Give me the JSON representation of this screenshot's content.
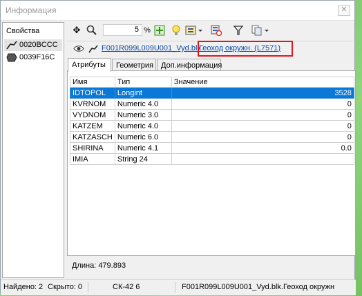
{
  "window": {
    "title": "Информация",
    "close": "✕"
  },
  "left_panel": {
    "header": "Свойства",
    "items": [
      {
        "label": "0020BCCC",
        "icon": "polyline-icon"
      },
      {
        "label": "0039F16C",
        "icon": "polygon-icon"
      }
    ]
  },
  "toolbar": {
    "zoom_value": "5",
    "percent_label": "%"
  },
  "object": {
    "file_link": "F001R099L009U001_Vyd.blk.",
    "layer_link": "Геоход окружн. (L7571)"
  },
  "tabs": [
    "Атрибуты",
    "Геометрия",
    "Доп.информация"
  ],
  "table": {
    "headers": [
      "Имя",
      "Тип",
      "Значение"
    ],
    "rows": [
      [
        "IDTOPOL",
        "Longint",
        "3528"
      ],
      [
        "KVRNOM",
        "Numeric 4.0",
        "0"
      ],
      [
        "VYDNOM",
        "Numeric 3.0",
        "0"
      ],
      [
        "KATZEM",
        "Numeric 4.0",
        "0"
      ],
      [
        "KATZASCH",
        "Numeric 6.0",
        "0"
      ],
      [
        "SHIRINA",
        "Numeric 4.1",
        "0.0"
      ],
      [
        "IMIA",
        "String 24",
        ""
      ]
    ]
  },
  "length_label": "Длина: 479.893",
  "status": {
    "found": "Найдено: 2",
    "hidden": "Скрыто: 0",
    "crs": "СК-42 6",
    "object": "F001R099L009U001_Vyd.blk.Геоход окружн"
  }
}
